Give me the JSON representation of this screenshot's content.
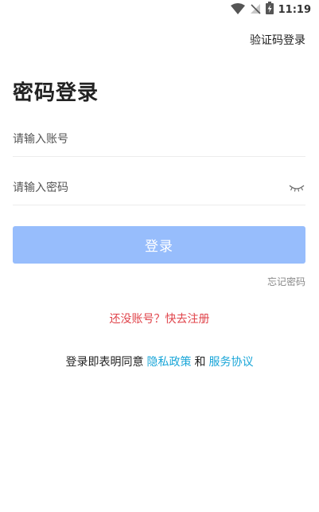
{
  "status_bar": {
    "time": "11:19",
    "icons": [
      "wifi-icon",
      "signal-off-icon",
      "battery-charging-icon"
    ]
  },
  "header": {
    "sms_login_label": "验证码登录"
  },
  "main": {
    "title": "密码登录",
    "account_placeholder": "请输入账号",
    "account_value": "",
    "password_placeholder": "请输入密码",
    "password_value": "",
    "password_toggle_icon": "eye-closed-icon",
    "login_label": "登录",
    "forgot_password_label": "忘记密码",
    "register_label": "还没账号？快去注册"
  },
  "agreement": {
    "prefix": "登录即表明同意",
    "privacy_label": "隐私政策",
    "conjunction": "和",
    "service_label": "服务协议"
  },
  "colors": {
    "login_button": "#97bdfc",
    "register_link": "#e0434a",
    "agreement_link": "#1aa6d8"
  }
}
